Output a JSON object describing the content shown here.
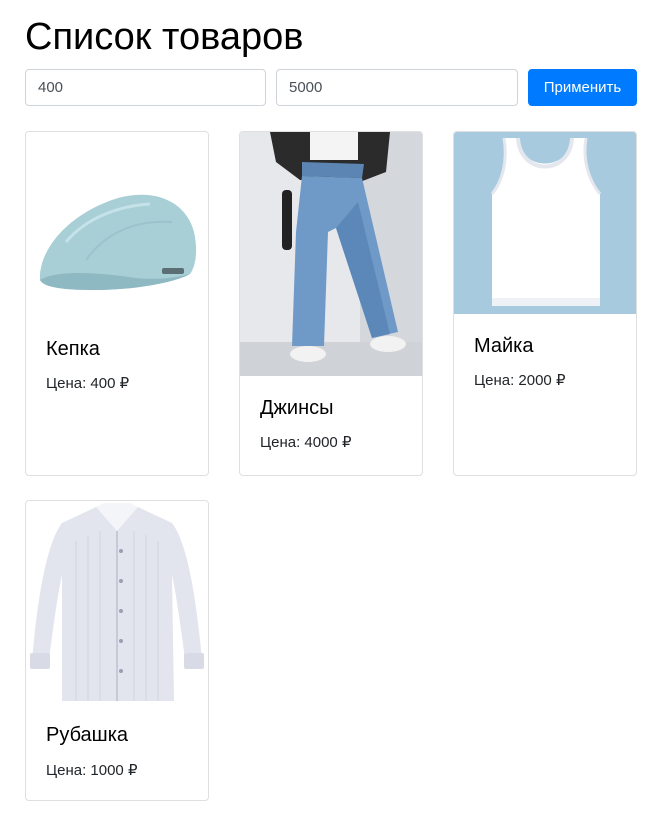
{
  "page": {
    "title": "Список товаров"
  },
  "filter": {
    "min_value": "400",
    "max_value": "5000",
    "apply_label": "Применить"
  },
  "products": [
    {
      "name": "Кепка",
      "price_label": "Цена:",
      "price": "400",
      "currency": "₽",
      "image_icon": "flat-cap-image"
    },
    {
      "name": "Джинсы",
      "price_label": "Цена:",
      "price": "4000",
      "currency": "₽",
      "image_icon": "jeans-photo"
    },
    {
      "name": "Майка",
      "price_label": "Цена:",
      "price": "2000",
      "currency": "₽",
      "image_icon": "tank-top-image"
    },
    {
      "name": "Рубашка",
      "price_label": "Цена:",
      "price": "1000",
      "currency": "₽",
      "image_icon": "dress-shirt-image"
    }
  ],
  "colors": {
    "accent": "#007bff",
    "border": "#dfdfdf"
  }
}
